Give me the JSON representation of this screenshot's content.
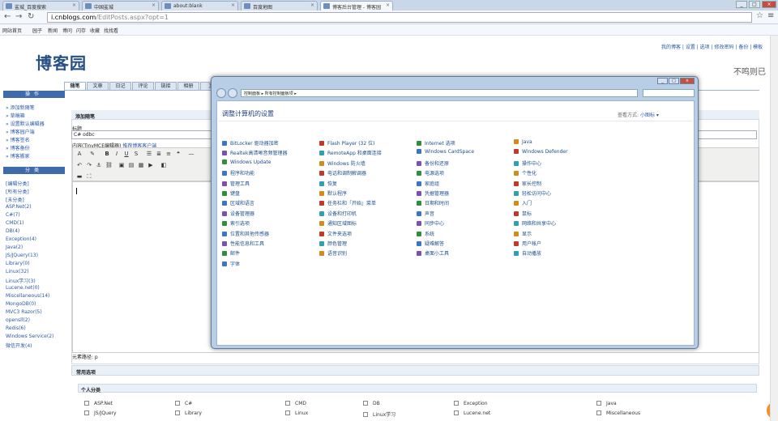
{
  "browser": {
    "tabs": [
      {
        "label": "鲨城_百度搜索",
        "active": false
      },
      {
        "label": "中国鲨城",
        "active": false
      },
      {
        "label": "about:blank",
        "active": false
      },
      {
        "label": "百度地图",
        "active": false
      },
      {
        "label": "博客后台管理 - 博客园",
        "active": true
      }
    ],
    "url_domain": "i.cnblogs.com",
    "url_path": "/EditPosts.aspx?opt=1",
    "bookmarks": [
      "网站首页",
      "园子",
      "新闻",
      "博问",
      "闪存",
      "收藏",
      "找找看"
    ]
  },
  "page": {
    "logo": "博客园",
    "top_links": "我的博客 | 设置 | 选项 | 修改密码 | 备份 | 模板",
    "username": "不鸣则已",
    "nav_tabs": [
      "随笔",
      "文章",
      "日记",
      "评论",
      "链接",
      "相册",
      "文"
    ],
    "sidebar": {
      "ops_title": "操作",
      "ops": [
        "添加新随笔",
        "草稿箱",
        "设置默认编辑器",
        "博客园户端",
        "博客签名",
        "博客备份",
        "博客搬家"
      ],
      "cat_title": "分类",
      "categories": [
        "[编辑分类]",
        "[所有分类]",
        "[未分类]",
        "ASP.Net(2)",
        "C#(7)",
        "CMD(1)",
        "DB(4)",
        "Exception(4)",
        "Java(2)",
        "JS/JQuery(13)",
        "Library(0)",
        "Linux(32)",
        "Linux学习(3)",
        "Lucene.net(0)",
        "Miscellaneous(14)",
        "MongoDB(0)",
        "MVC3 Razor(5)",
        "opensll(2)",
        "Redis(6)",
        "Windows Service(2)",
        "微信开发(4)"
      ]
    },
    "editor": {
      "header": "添加随笔",
      "title_label": "标题",
      "title_value": "C# odbc",
      "content_label": "内容(TinyMCE编辑器)",
      "content_link": "推荐博客客户端",
      "path_label": "元素路径: p",
      "options_header": "常用选项",
      "personal_header": "个人分类",
      "checkboxes": [
        "ASP.Net",
        "C#",
        "CMD",
        "DB",
        "Exception",
        "Java",
        "JS/JQuery",
        "Library",
        "Linux",
        "Linux学习",
        "Lucene.net",
        "Miscellaneous"
      ]
    }
  },
  "control_panel": {
    "breadcrumb": "控制面板 ▸ 所有控制面板项 ▸",
    "title": "调整计算机的设置",
    "view_label": "查看方式:",
    "view_value": "小图标 ▾",
    "items": [
      [
        "BitLocker 驱动器加密",
        "Flash Player (32 位)",
        "Internet 选项",
        "Java"
      ],
      [
        "Realtek高清晰音频管理器",
        "RemoteApp 和桌面连接",
        "Windows CardSpace",
        "Windows Defender"
      ],
      [
        "Windows Update",
        "Windows 防火墙",
        "备份和还原",
        "操作中心"
      ],
      [
        "程序和功能",
        "电话和调制解调器",
        "电源选项",
        "个性化"
      ],
      [
        "管理工具",
        "恢复",
        "家庭组",
        "家长控制"
      ],
      [
        "键盘",
        "默认程序",
        "凭据管理器",
        "轻松访问中心"
      ],
      [
        "区域和语言",
        "任务栏和「开始」菜单",
        "日期和时间",
        "入门"
      ],
      [
        "设备管理器",
        "设备和打印机",
        "声音",
        "鼠标"
      ],
      [
        "索引选项",
        "通知区域图标",
        "同步中心",
        "网络和共享中心"
      ],
      [
        "位置和其他传感器",
        "文件夹选项",
        "系统",
        "显示"
      ],
      [
        "性能信息和工具",
        "颜色管理",
        "疑难解答",
        "用户帐户"
      ],
      [
        "邮件",
        "语音识别",
        "桌面小工具",
        "自动播放"
      ],
      [
        "字体",
        "",
        "",
        ""
      ]
    ]
  }
}
